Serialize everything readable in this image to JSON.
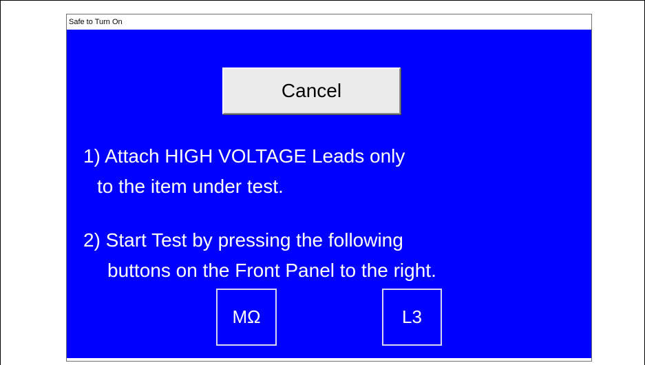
{
  "window": {
    "title": "Safe to Turn On"
  },
  "dialog": {
    "cancel_label": "Cancel",
    "step1": {
      "line1": "1) Attach HIGH VOLTAGE Leads only",
      "line2": "to the item under test."
    },
    "step2": {
      "line1": "2) Start Test by pressing the following",
      "line2": "buttons on the Front Panel to the right."
    },
    "panel_keys": [
      {
        "label": "MΩ"
      },
      {
        "label": "L3"
      }
    ]
  },
  "colors": {
    "background": "#0000ff",
    "text": "#ffffff",
    "button_face": "#ebebeb"
  }
}
